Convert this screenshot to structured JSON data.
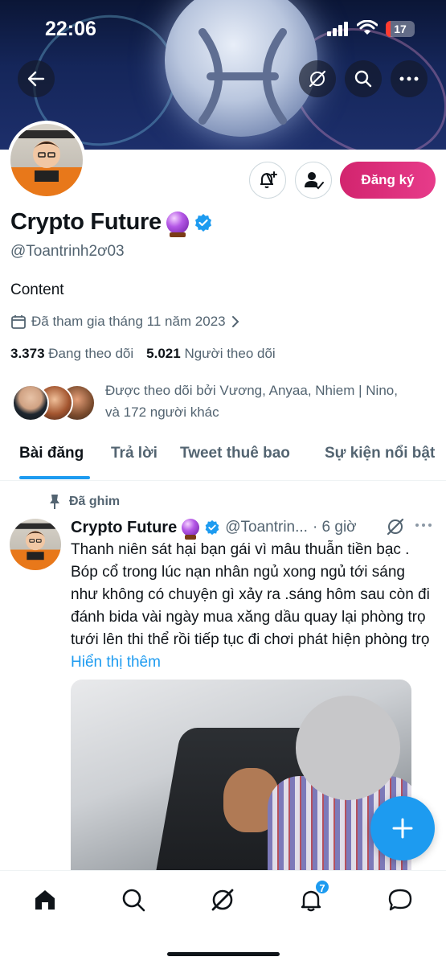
{
  "status_bar": {
    "time": "22:06",
    "battery": "17"
  },
  "profile": {
    "display_name": "Crypto Future",
    "handle": "@Toantrinh2ơ03",
    "bio": "Content",
    "joined": "Đã tham gia tháng 11 năm 2023",
    "following_count": "3.373",
    "following_label": "Đang theo dõi",
    "followers_count": "5.021",
    "followers_label": "Người theo dõi",
    "followed_by_line1": "Được theo dõi bởi Vương, Anyaa, Nhiem | Nino,",
    "followed_by_line2": "và 172 người khác",
    "subscribe_label": "Đăng ký"
  },
  "tabs": [
    {
      "label": "Bài đăng",
      "active": true
    },
    {
      "label": "Trả lời",
      "active": false
    },
    {
      "label": "Tweet thuê bao",
      "active": false
    },
    {
      "label": "Sự kiện nổi bật",
      "active": false
    }
  ],
  "tweet": {
    "pinned_label": "Đã ghim",
    "author_name": "Crypto Future",
    "author_handle": "@Toantrin...",
    "time": "· 6 giờ",
    "text": "Thanh niên sát hại bạn gái vì mâu thuẫn tiền bạc . Bóp cổ trong lúc nạn nhân ngủ xong ngủ tới sáng như không có chuyện gì xảy ra .sáng hôm sau còn đi đánh bida vài ngày mua xăng dầu quay lại phòng trọ tưới lên thi thể rồi tiếp tục đi chơi phát hiện phòng trọ",
    "show_more": "Hiển thị thêm"
  },
  "bottom_nav": {
    "items": [
      "home-icon",
      "search-icon",
      "grok-icon",
      "notifications-icon",
      "messages-icon"
    ],
    "notifications_badge": "7"
  },
  "colors": {
    "accent": "#1d9bf0",
    "subscribe": "#d2246e",
    "text": "#0f1419",
    "secondary": "#536471"
  }
}
